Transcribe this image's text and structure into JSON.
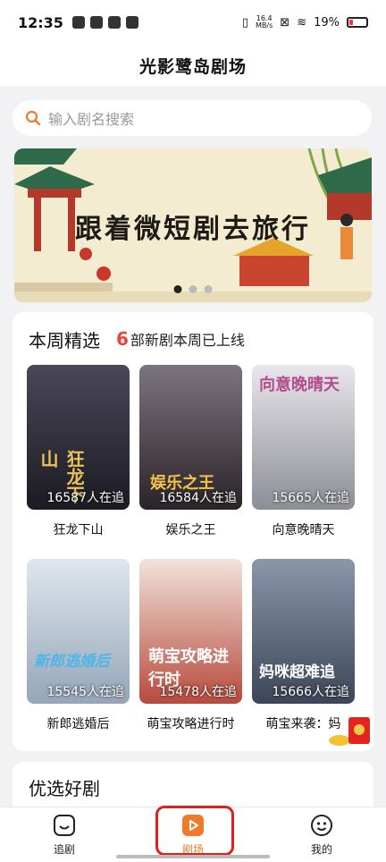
{
  "status": {
    "time": "12:35",
    "speed": "16.4\nMB/s",
    "battery": "19%"
  },
  "header": {
    "title": "光影鹭岛剧场"
  },
  "search": {
    "placeholder": "输入剧名搜索"
  },
  "banner": {
    "text": "跟着微短剧去旅行",
    "page_count": 3,
    "active_page": 1
  },
  "weekly": {
    "title": "本周精选",
    "count": "6",
    "sub": "部新剧本周已上线",
    "dramas": [
      {
        "name": "狂龙下山",
        "followers": "16587人在追",
        "poster_title": "狂龙下山",
        "color": "#2c2a36"
      },
      {
        "name": "娱乐之王",
        "followers": "16584人在追",
        "poster_title": "娱乐之王",
        "color": "#3a3438"
      },
      {
        "name": "向意晚晴天",
        "followers": "15665人在追",
        "poster_title": "向意晚晴天",
        "color": "#c9c6cc"
      },
      {
        "name": "新郎逃婚后",
        "followers": "15545人在追",
        "poster_title": "新郎逃婚后",
        "color": "#b7c3cf"
      },
      {
        "name": "萌宝攻略进行时",
        "followers": "15478人在追",
        "poster_title": "萌宝攻略进行时",
        "color": "#c45b48"
      },
      {
        "name": "萌宝来袭：妈",
        "followers": "15666人在追",
        "poster_title": "妈咪超难追",
        "color": "#5b6a80"
      }
    ]
  },
  "picks": {
    "title": "优选好剧"
  },
  "tabs": [
    {
      "label": "追剧",
      "icon": "bookmark-smile-icon"
    },
    {
      "label": "剧场",
      "icon": "play-icon"
    },
    {
      "label": "我的",
      "icon": "face-icon"
    }
  ]
}
